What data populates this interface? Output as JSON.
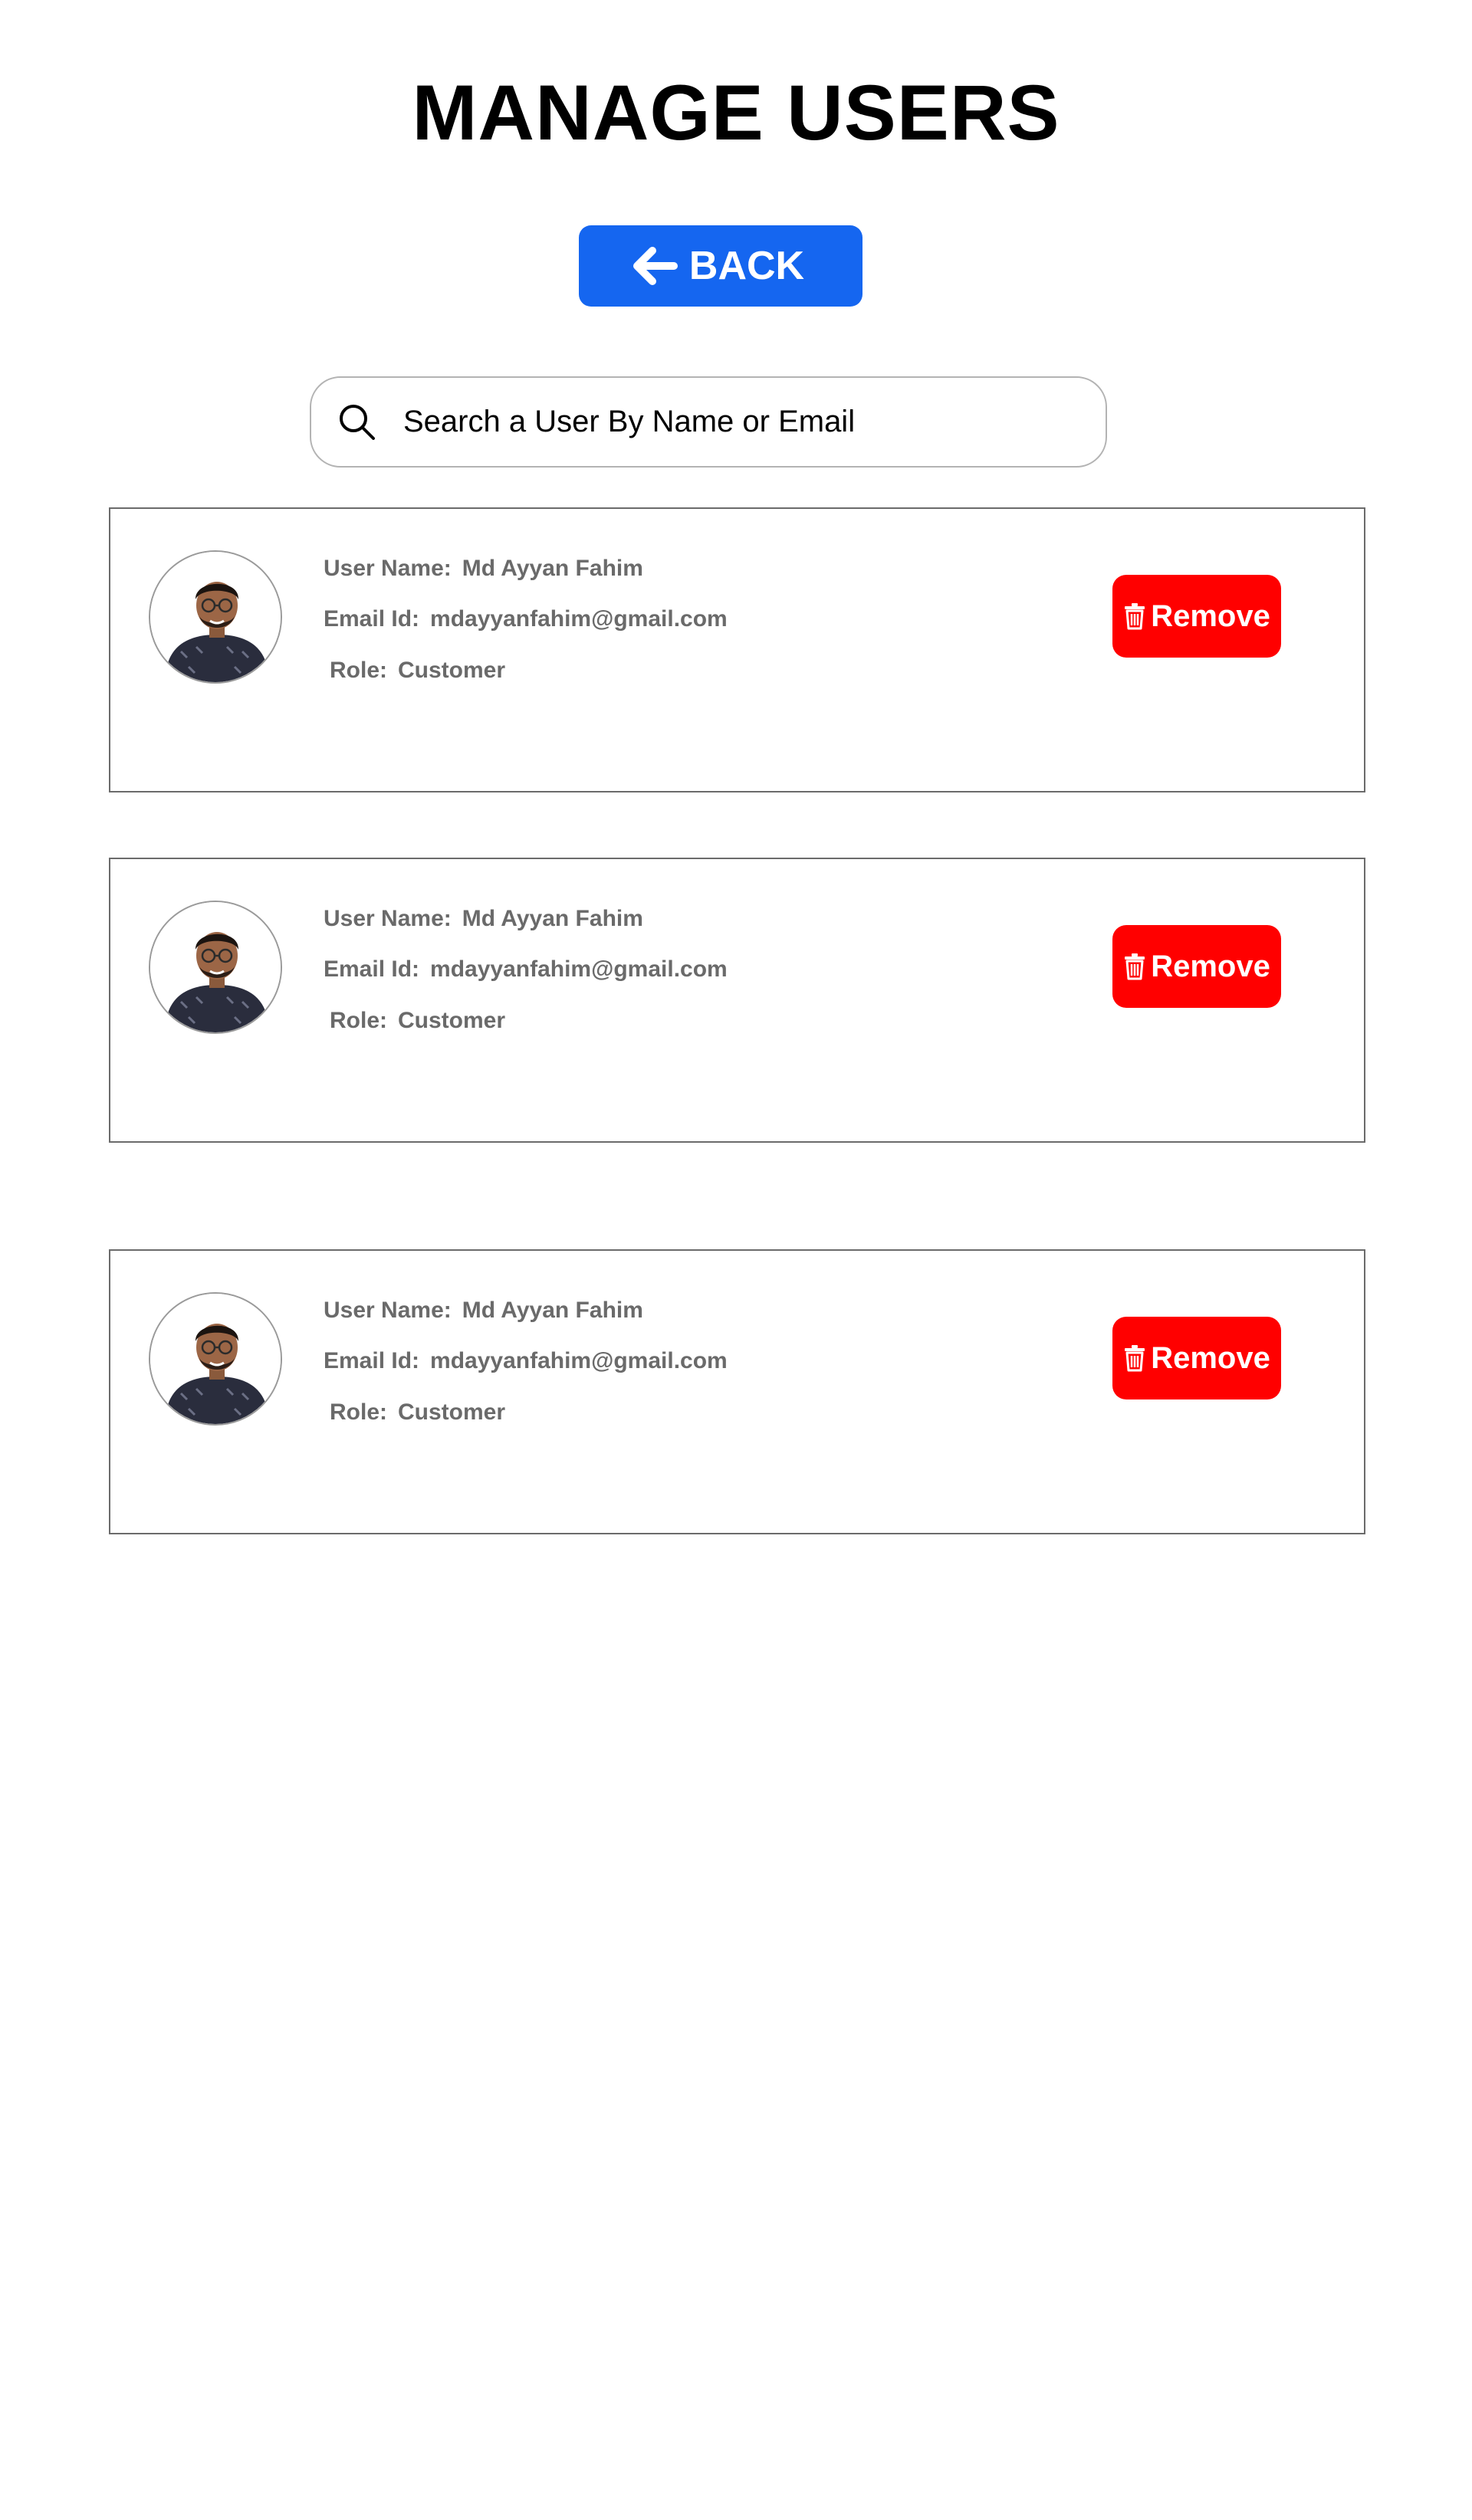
{
  "header": {
    "title": "MANAGE USERS",
    "back_label": "BACK",
    "back_icon": "arrow-left-icon"
  },
  "search": {
    "placeholder": "Search a User By Name or Email",
    "value": "",
    "icon": "search-icon"
  },
  "labels": {
    "user_name": "User Name:",
    "email": "Email Id:",
    "role": "Role:"
  },
  "users": [
    {
      "name": "Md Ayyan Fahim",
      "email": "mdayyanfahim@gmail.com",
      "role": "Customer",
      "remove_label": "Remove",
      "remove_icon": "trash-icon"
    },
    {
      "name": "Md Ayyan Fahim",
      "email": "mdayyanfahim@gmail.com",
      "role": "Customer",
      "remove_label": "Remove",
      "remove_icon": "trash-icon"
    },
    {
      "name": "Md Ayyan Fahim",
      "email": "mdayyanfahim@gmail.com",
      "role": "Customer",
      "remove_label": "Remove",
      "remove_icon": "trash-icon"
    }
  ],
  "colors": {
    "back_button": "#1566f0",
    "remove_button": "#ff0000",
    "info_text": "#6a6a6a",
    "card_border": "#6b6b6b"
  }
}
